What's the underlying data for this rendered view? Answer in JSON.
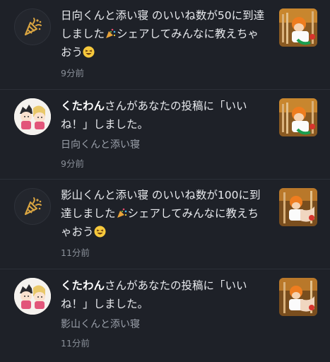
{
  "notifications": [
    {
      "type": "milestone",
      "icon": "party-popper-icon",
      "text_main": "日向くんと添い寝 のいいね数が50に到達しました",
      "text_tail": "シェアしてみんなに教えちゃおう",
      "time": "9分前"
    },
    {
      "type": "like",
      "user": "くたわん",
      "text_main": "さんがあなたの投稿に「いいね！」しました。",
      "post_title": "日向くんと添い寝",
      "time": "9分前"
    },
    {
      "type": "milestone",
      "icon": "party-popper-icon",
      "text_main": "影山くんと添い寝 のいいね数が100に到達しました",
      "text_tail": "シェアしてみんなに教えちゃおう",
      "time": "11分前"
    },
    {
      "type": "like",
      "user": "くたわん",
      "text_main": "さんがあなたの投稿に「いいね！」しました。",
      "post_title": "影山くんと添い寝",
      "time": "11分前"
    }
  ],
  "colors": {
    "background": "#1e2128",
    "accent_gold": "#d9a441",
    "text": "#e8eaee",
    "muted": "#9aa0aa"
  }
}
